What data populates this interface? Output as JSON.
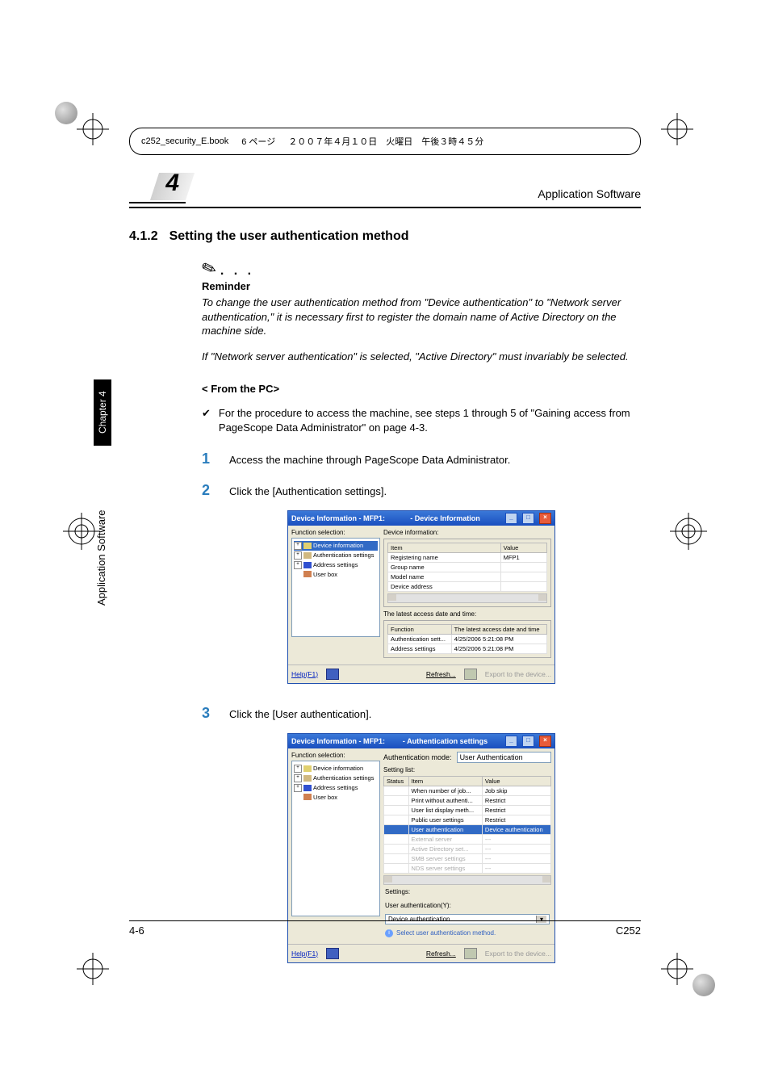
{
  "running_header": {
    "filename": "c252_security_E.book",
    "pageinfo": "6 ページ",
    "date": "２００７年４月１０日　火曜日　午後３時４５分"
  },
  "header": {
    "chapter_number": "4",
    "app_title": "Application Software"
  },
  "sidebar": {
    "chapter_label": "Chapter 4",
    "title": "Application Software"
  },
  "section": {
    "number": "4.1.2",
    "title": "Setting the user authentication method"
  },
  "reminder": {
    "dots": ". . .",
    "label": "Reminder",
    "para1": "To change the user authentication method from \"Device authentication\" to \"Network server authentication,\" it is necessary first to register the domain name of Active Directory on the machine side.",
    "para2": "If \"Network server authentication\" is selected, \"Active Directory\" must invariably be selected."
  },
  "from_pc": {
    "heading": "< From the PC>",
    "check_text": "For the procedure to access the machine, see steps 1 through 5 of \"Gaining access from PageScope Data Administrator\" on page 4-3."
  },
  "steps": {
    "s1_num": "1",
    "s1_text": "Access the machine through PageScope Data Administrator.",
    "s2_num": "2",
    "s2_text": "Click the [Authentication settings].",
    "s3_num": "3",
    "s3_text": "Click the [User authentication]."
  },
  "shot1": {
    "title_left": "Device Information - MFP1:",
    "title_center": "- Device Information",
    "func_sel": "Function selection:",
    "tree": {
      "device_info": "Device information",
      "auth_settings": "Authentication settings",
      "addr_settings": "Address settings",
      "user_box": "User box"
    },
    "right_label": "Device information:",
    "tbl_item": "Item",
    "tbl_value": "Value",
    "rows": {
      "reg_name": "Registering name",
      "reg_val": "MFP1",
      "grp_name": "Group name",
      "model_name": "Model name",
      "dev_addr": "Device address"
    },
    "latest_label": "The latest access date and time:",
    "lat_func": "Function",
    "lat_date": "The latest access date and time",
    "lat_auth": "Authentication sett...",
    "lat_addr": "Address settings",
    "lat_d1": "4/25/2006 5:21:08 PM",
    "lat_d2": "4/25/2006 5:21:08 PM",
    "help": "Help(F1)",
    "refresh": "Refresh...",
    "export": "Export to the device..."
  },
  "shot2": {
    "title_left": "Device Information - MFP1:",
    "title_center": "- Authentication settings",
    "func_sel": "Function selection:",
    "tree": {
      "device_info": "Device information",
      "auth_settings": "Authentication settings",
      "addr_settings": "Address settings",
      "user_box": "User box"
    },
    "authmode_lbl": "Authentication mode:",
    "authmode_val": "User Authentication",
    "setlist_lbl": "Setting list:",
    "col_status": "Status",
    "col_item": "Item",
    "col_value": "Value",
    "rows": {
      "r1_item": "When number of job...",
      "r1_val": "Job skip",
      "r2_item": "Print without authenti...",
      "r2_val": "Restrict",
      "r3_item": "User list display meth...",
      "r3_val": "Restrict",
      "r4_item": "Public user settings",
      "r4_val": "Restrict",
      "r5_item": "User authentication",
      "r5_val": "Device authentication",
      "r6_item": "External server",
      "r6_val": "---",
      "r7_item": "Active Directory set...",
      "r7_val": "---",
      "r8_item": "SMB server settings",
      "r8_val": "---",
      "r9_item": "NDS server settings",
      "r9_val": "---"
    },
    "settings_lbl": "Settings:",
    "ua_lbl": "User authentication(Y):",
    "dd_val": "Device authentication",
    "hint": "Select user authentication method.",
    "help": "Help(F1)",
    "refresh": "Refresh...",
    "export": "Export to the device..."
  },
  "footer": {
    "page": "4-6",
    "model": "C252"
  }
}
